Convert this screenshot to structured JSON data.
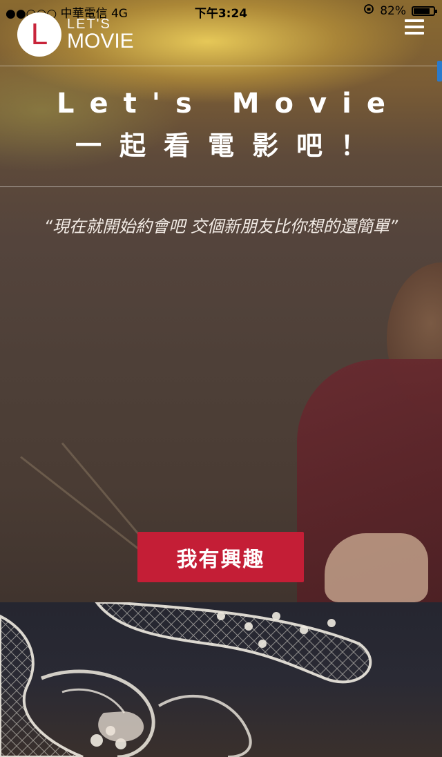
{
  "status_bar": {
    "carrier": "●●○○○ 中華電信  4G",
    "time": "下午3:24",
    "battery": "82%",
    "battery_level": 0.82
  },
  "navbar": {
    "logo_letter": "L",
    "logo_line1": "LET'S",
    "logo_line2": "MOVIE",
    "menu_icon": "hamburger-menu-icon"
  },
  "hero": {
    "title_en": "Let's Movie",
    "title_zh": "一起看電影吧！",
    "quote": "“現在就開始約會吧 交個新朋友比你想的還簡單”",
    "cta_label": "我有興趣",
    "cta_color": "#c41e36"
  }
}
